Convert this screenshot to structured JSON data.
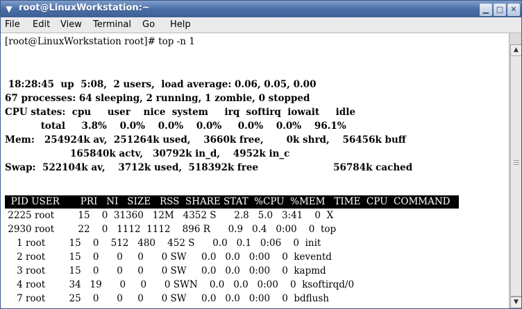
{
  "window": {
    "title": "root@LinuxWorkstation:~",
    "menu_icon": "▼",
    "minimize": "▁",
    "maximize": "□",
    "close": "✕"
  },
  "menubar": {
    "items": [
      {
        "label": "File"
      },
      {
        "label": "Edit"
      },
      {
        "label": "View"
      },
      {
        "label": "Terminal"
      },
      {
        "label": "Go"
      },
      {
        "label": "Help"
      }
    ]
  },
  "terminal": {
    "prompt_line": "[root@LinuxWorkstation root]# top -n 1",
    "summary": [
      " 18:28:45  up  5:08,  2 users,  load average: 0.06, 0.05, 0.00",
      "67 processes: 64 sleeping, 2 running, 1 zombie, 0 stopped",
      "CPU states:  cpu     user    nice  system     irq  softirq  iowait     idle",
      "           total     3.8%    0.0%    0.0%    0.0%     0.0%    0.0%    96.1%",
      "Mem:   254924k av,  251264k used,    3660k free,       0k shrd,    56456k buff",
      "                    165840k actv,   30792k in_d,    4952k in_c",
      "Swap:  522104k av,    3712k used,  518392k free                       56784k cached"
    ],
    "table_header": "  PID USER       PRI   NI   SIZE   RSS  SHARE STAT  %CPU  %MEM   TIME  CPU  COMMAND",
    "rows": [
      " 2225 root        15    0  31360   12M   4352 S      2.8   5.0   3:41    0  X",
      " 2930 root        22    0   1112  1112    896 R      0.9   0.4   0:00    0  top",
      "    1 root        15    0    512   480    452 S      0.0   0.1   0:06    0  init",
      "    2 root        15    0      0     0      0 SW     0.0   0.0   0:00    0  keventd",
      "    3 root        15    0      0     0      0 SW     0.0   0.0   0:00    0  kapmd",
      "    4 root        34   19      0     0      0 SWN    0.0   0.0   0:00    0  ksoftirqd/0",
      "    7 root        25    0      0     0      0 SW     0.0   0.0   0:00    0  bdflush"
    ]
  },
  "scrollbar": {
    "up_arrow": "▲",
    "down_arrow": "▼"
  }
}
